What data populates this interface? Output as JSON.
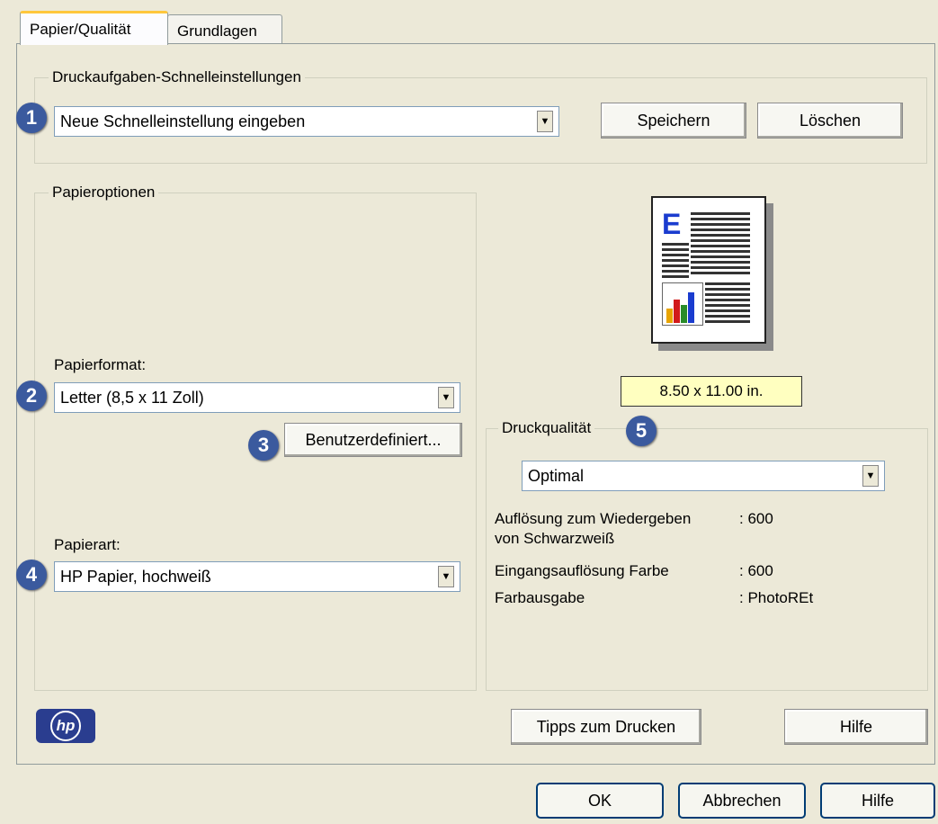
{
  "tabs": [
    {
      "label": "Papier/Qualität",
      "active": true
    },
    {
      "label": "Grundlagen",
      "active": false
    }
  ],
  "quick_settings": {
    "legend": "Druckaufgaben-Schnelleinstellungen",
    "select_value": "Neue Schnelleinstellung eingeben",
    "save_label": "Speichern",
    "delete_label": "Löschen",
    "badge": "1"
  },
  "paper_options": {
    "legend": "Papieroptionen",
    "format_label": "Papierformat:",
    "format_value": "Letter (8,5 x 11 Zoll)",
    "format_badge": "2",
    "custom_label": "Benutzerdefiniert...",
    "custom_badge": "3",
    "type_label": "Papierart:",
    "type_value": "HP Papier, hochweiß",
    "type_badge": "4"
  },
  "preview": {
    "size_text": "8.50 x 11.00 in.",
    "letter": "E"
  },
  "print_quality": {
    "legend": "Druckqualität",
    "badge": "5",
    "select_value": "Optimal",
    "rows": [
      {
        "label": "Auflösung zum Wiedergeben\nvon Schwarzweiß",
        "value": ": 600"
      },
      {
        "label": "Eingangsauflösung Farbe",
        "value": ": 600"
      },
      {
        "label": "Farbausgabe",
        "value": ": PhotoREt"
      }
    ]
  },
  "footer": {
    "logo": "hp",
    "tips_label": "Tipps zum Drucken",
    "help_label": "Hilfe"
  },
  "dialog_buttons": {
    "ok": "OK",
    "cancel": "Abbrechen",
    "help": "Hilfe"
  },
  "colors": {
    "badge": "#3b5a9e",
    "size_box": "#ffffc0",
    "tab_accent": "#ffc73c",
    "hp_logo": "#2a3d8f"
  }
}
